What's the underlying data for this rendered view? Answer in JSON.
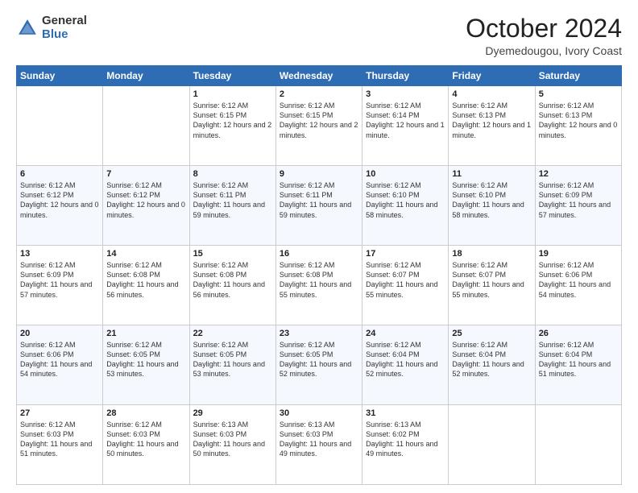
{
  "header": {
    "logo": {
      "general": "General",
      "blue": "Blue"
    },
    "title": "October 2024",
    "location": "Dyemedougou, Ivory Coast"
  },
  "days_of_week": [
    "Sunday",
    "Monday",
    "Tuesday",
    "Wednesday",
    "Thursday",
    "Friday",
    "Saturday"
  ],
  "weeks": [
    [
      {
        "day": "",
        "content": ""
      },
      {
        "day": "",
        "content": ""
      },
      {
        "day": "1",
        "content": "Sunrise: 6:12 AM\nSunset: 6:15 PM\nDaylight: 12 hours\nand 2 minutes."
      },
      {
        "day": "2",
        "content": "Sunrise: 6:12 AM\nSunset: 6:15 PM\nDaylight: 12 hours\nand 2 minutes."
      },
      {
        "day": "3",
        "content": "Sunrise: 6:12 AM\nSunset: 6:14 PM\nDaylight: 12 hours\nand 1 minute."
      },
      {
        "day": "4",
        "content": "Sunrise: 6:12 AM\nSunset: 6:13 PM\nDaylight: 12 hours\nand 1 minute."
      },
      {
        "day": "5",
        "content": "Sunrise: 6:12 AM\nSunset: 6:13 PM\nDaylight: 12 hours\nand 0 minutes."
      }
    ],
    [
      {
        "day": "6",
        "content": "Sunrise: 6:12 AM\nSunset: 6:12 PM\nDaylight: 12 hours\nand 0 minutes."
      },
      {
        "day": "7",
        "content": "Sunrise: 6:12 AM\nSunset: 6:12 PM\nDaylight: 12 hours\nand 0 minutes."
      },
      {
        "day": "8",
        "content": "Sunrise: 6:12 AM\nSunset: 6:11 PM\nDaylight: 11 hours\nand 59 minutes."
      },
      {
        "day": "9",
        "content": "Sunrise: 6:12 AM\nSunset: 6:11 PM\nDaylight: 11 hours\nand 59 minutes."
      },
      {
        "day": "10",
        "content": "Sunrise: 6:12 AM\nSunset: 6:10 PM\nDaylight: 11 hours\nand 58 minutes."
      },
      {
        "day": "11",
        "content": "Sunrise: 6:12 AM\nSunset: 6:10 PM\nDaylight: 11 hours\nand 58 minutes."
      },
      {
        "day": "12",
        "content": "Sunrise: 6:12 AM\nSunset: 6:09 PM\nDaylight: 11 hours\nand 57 minutes."
      }
    ],
    [
      {
        "day": "13",
        "content": "Sunrise: 6:12 AM\nSunset: 6:09 PM\nDaylight: 11 hours\nand 57 minutes."
      },
      {
        "day": "14",
        "content": "Sunrise: 6:12 AM\nSunset: 6:08 PM\nDaylight: 11 hours\nand 56 minutes."
      },
      {
        "day": "15",
        "content": "Sunrise: 6:12 AM\nSunset: 6:08 PM\nDaylight: 11 hours\nand 56 minutes."
      },
      {
        "day": "16",
        "content": "Sunrise: 6:12 AM\nSunset: 6:08 PM\nDaylight: 11 hours\nand 55 minutes."
      },
      {
        "day": "17",
        "content": "Sunrise: 6:12 AM\nSunset: 6:07 PM\nDaylight: 11 hours\nand 55 minutes."
      },
      {
        "day": "18",
        "content": "Sunrise: 6:12 AM\nSunset: 6:07 PM\nDaylight: 11 hours\nand 55 minutes."
      },
      {
        "day": "19",
        "content": "Sunrise: 6:12 AM\nSunset: 6:06 PM\nDaylight: 11 hours\nand 54 minutes."
      }
    ],
    [
      {
        "day": "20",
        "content": "Sunrise: 6:12 AM\nSunset: 6:06 PM\nDaylight: 11 hours\nand 54 minutes."
      },
      {
        "day": "21",
        "content": "Sunrise: 6:12 AM\nSunset: 6:05 PM\nDaylight: 11 hours\nand 53 minutes."
      },
      {
        "day": "22",
        "content": "Sunrise: 6:12 AM\nSunset: 6:05 PM\nDaylight: 11 hours\nand 53 minutes."
      },
      {
        "day": "23",
        "content": "Sunrise: 6:12 AM\nSunset: 6:05 PM\nDaylight: 11 hours\nand 52 minutes."
      },
      {
        "day": "24",
        "content": "Sunrise: 6:12 AM\nSunset: 6:04 PM\nDaylight: 11 hours\nand 52 minutes."
      },
      {
        "day": "25",
        "content": "Sunrise: 6:12 AM\nSunset: 6:04 PM\nDaylight: 11 hours\nand 52 minutes."
      },
      {
        "day": "26",
        "content": "Sunrise: 6:12 AM\nSunset: 6:04 PM\nDaylight: 11 hours\nand 51 minutes."
      }
    ],
    [
      {
        "day": "27",
        "content": "Sunrise: 6:12 AM\nSunset: 6:03 PM\nDaylight: 11 hours\nand 51 minutes."
      },
      {
        "day": "28",
        "content": "Sunrise: 6:12 AM\nSunset: 6:03 PM\nDaylight: 11 hours\nand 50 minutes."
      },
      {
        "day": "29",
        "content": "Sunrise: 6:13 AM\nSunset: 6:03 PM\nDaylight: 11 hours\nand 50 minutes."
      },
      {
        "day": "30",
        "content": "Sunrise: 6:13 AM\nSunset: 6:03 PM\nDaylight: 11 hours\nand 49 minutes."
      },
      {
        "day": "31",
        "content": "Sunrise: 6:13 AM\nSunset: 6:02 PM\nDaylight: 11 hours\nand 49 minutes."
      },
      {
        "day": "",
        "content": ""
      },
      {
        "day": "",
        "content": ""
      }
    ]
  ]
}
